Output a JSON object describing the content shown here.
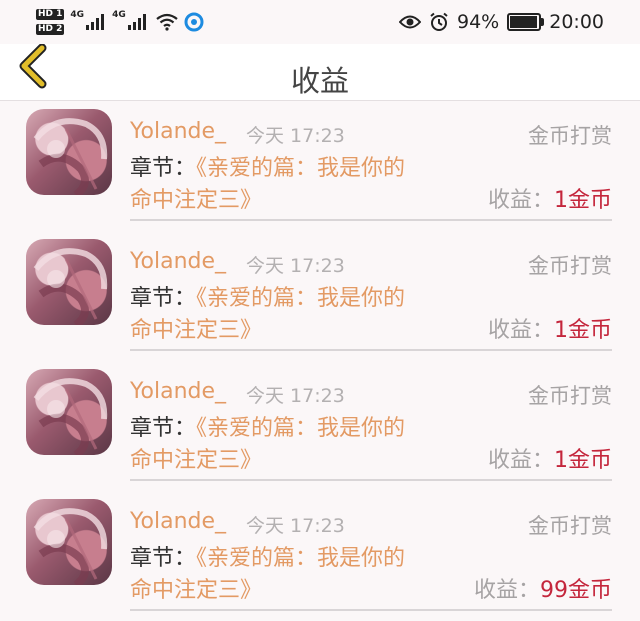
{
  "status_bar": {
    "sim1": "HD 1",
    "sim2": "HD 2",
    "network1": "4G",
    "network2": "4G",
    "battery": "94%",
    "time": "20:00"
  },
  "nav": {
    "title": "收益"
  },
  "items": [
    {
      "user": "Yolande_",
      "time": "今天 17:23",
      "type": "金币打赏",
      "chapter_label": "章节：",
      "chapter_part1": "《亲爱的篇：我是你的",
      "chapter_part2": "命中注定三》",
      "earn_label": "收益：",
      "earn_value": "1金币"
    },
    {
      "user": "Yolande_",
      "time": "今天 17:23",
      "type": "金币打赏",
      "chapter_label": "章节：",
      "chapter_part1": "《亲爱的篇：我是你的",
      "chapter_part2": "命中注定三》",
      "earn_label": "收益：",
      "earn_value": "1金币"
    },
    {
      "user": "Yolande_",
      "time": "今天 17:23",
      "type": "金币打赏",
      "chapter_label": "章节：",
      "chapter_part1": "《亲爱的篇：我是你的",
      "chapter_part2": "命中注定三》",
      "earn_label": "收益：",
      "earn_value": "1金币"
    },
    {
      "user": "Yolande_",
      "time": "今天 17:23",
      "type": "金币打赏",
      "chapter_label": "章节：",
      "chapter_part1": "《亲爱的篇：我是你的",
      "chapter_part2": "命中注定三》",
      "earn_label": "收益：",
      "earn_value": "99金币"
    }
  ],
  "colors": {
    "accent": "#e39a64",
    "earn_value": "#c4263c",
    "back_arrow": "#d9b11a"
  }
}
